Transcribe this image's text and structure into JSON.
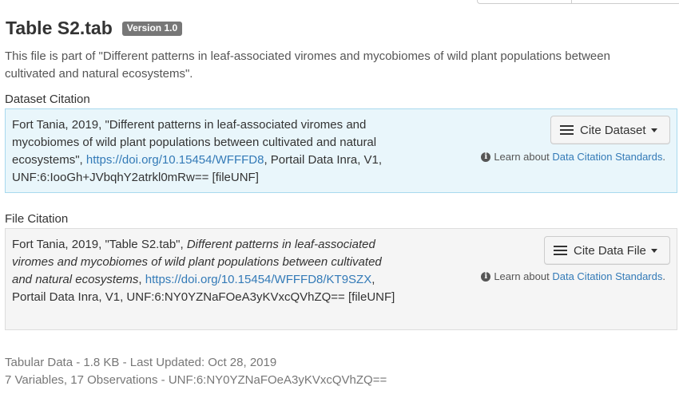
{
  "header": {
    "title": "Table S2.tab",
    "version_badge": "Version 1.0"
  },
  "description": "This file is part of \"Different patterns in leaf-associated viromes and mycobiomes of wild plant populations between cultivated and natural ecosystems\".",
  "dataset_citation": {
    "label": "Dataset Citation",
    "text_before": "Fort Tania, 2019, \"Different patterns in leaf-associated viromes and mycobiomes of wild plant populations between cultivated and natural ecosystems\", ",
    "doi": "https://doi.org/10.15454/WFFFD8",
    "text_after": ", Portail Data Inra, V1, UNF:6:IooGh+JVbqhY2atrkl0mRw== [fileUNF]",
    "button_label": "Cite Dataset",
    "learn_prefix": "Learn about ",
    "learn_link": "Data Citation Standards",
    "learn_suffix": "."
  },
  "file_citation": {
    "label": "File Citation",
    "text_before": "Fort Tania, 2019, \"Table S2.tab\", ",
    "title_italic": "Different patterns in leaf-associated viromes and mycobiomes of wild plant populations between cultivated and natural ecosystems",
    "comma": ", ",
    "doi": "https://doi.org/10.15454/WFFFD8/KT9SZX",
    "text_after": ", Portail Data Inra, V1, UNF:6:NY0YZNaFOeA3yKVxcQVhZQ== [fileUNF]",
    "button_label": "Cite Data File",
    "learn_prefix": "Learn about ",
    "learn_link": "Data Citation Standards",
    "learn_suffix": "."
  },
  "file_meta": {
    "line1": "Tabular Data - 1.8 KB - Last Updated: Oct 28, 2019",
    "line2": "7 Variables, 17 Observations - UNF:6:NY0YZNaFOeA3yKVxcQVhZQ=="
  },
  "icons": {
    "list": "list-icon",
    "info": "info-icon",
    "caret": "caret-down-icon"
  },
  "colors": {
    "link": "#337ab7",
    "dataset_box_bg": "#e9f6fb",
    "file_box_bg": "#f5f5f5",
    "badge_bg": "#777777"
  }
}
